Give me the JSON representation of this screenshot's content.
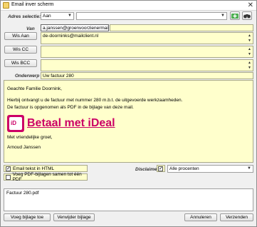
{
  "window": {
    "title": "Email inver scherm",
    "close_symbol": "✕"
  },
  "address": {
    "label": "Adres selectie:",
    "selected": "Aan",
    "second_select": ""
  },
  "fields": {
    "van_label": "Van",
    "van_value": "a.janssen@groenvoorzienermail.nl",
    "aan_button": "Wis Aan",
    "aan_value": "de-doorninks@mailclient.nl",
    "cc_button": "Wis CC",
    "cc_value": "",
    "bcc_button": "Wis BCC",
    "bcc_value": "",
    "subject_label": "Onderwerp",
    "subject_value": "Uw factuur 280"
  },
  "body": {
    "greeting": "Geachte Familie Doornink,",
    "line1": "Hierbij ontvangt u de factuur met nummer 280 m.b.t. de uitgevoerde werkzaamheden.",
    "line2": "De factuur is opgenomen als PDF in de bijlage van deze mail.",
    "ideal_logo_text": "iD",
    "pay_link": "Betaal met iDeal",
    "closing": "Met vriendelijke groet,",
    "signature": "Arnoud Janssen"
  },
  "options": {
    "html_label": "Email tekst in HTML",
    "html_checked": true,
    "merge_label": "Voeg PDF-bijlagen samen tot één PDF",
    "merge_checked": false,
    "disclaimer_label": "Disclaimer",
    "disclaimer_checked": true,
    "disclaimer_select": "Alle procenten"
  },
  "attachments": [
    "Factuur 280.pdf"
  ],
  "buttons": {
    "add_attachment": "Voeg bijlage toe",
    "remove_attachment": "Verwijder bijlage",
    "cancel": "Annuleren",
    "send": "Verzenden"
  },
  "colors": {
    "field_bg": "#ffffcc",
    "ideal_pink": "#cc0066"
  }
}
